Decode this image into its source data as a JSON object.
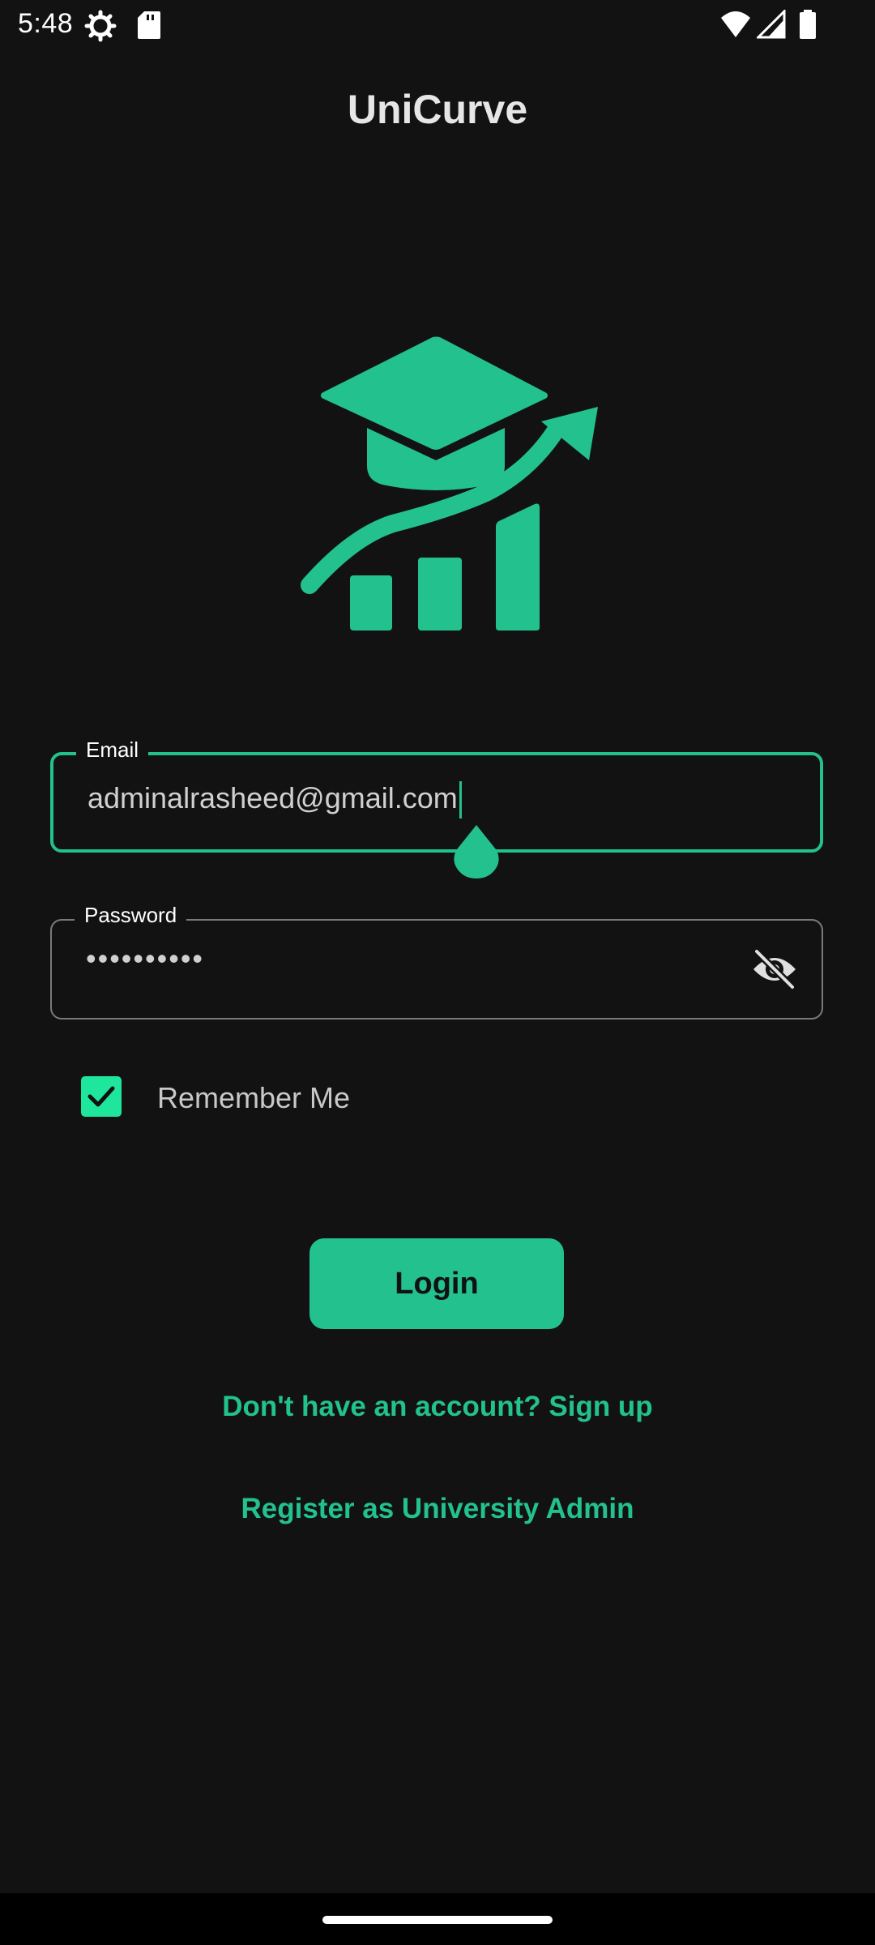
{
  "status_bar": {
    "time": "5:48",
    "icons": [
      "gear-icon",
      "sd-card-icon",
      "wifi-icon",
      "signal-icon",
      "battery-icon"
    ]
  },
  "app": {
    "title": "UniCurve",
    "logo": "graduation-cap-growth-chart-logo",
    "accent_color": "#23c18e"
  },
  "form": {
    "email": {
      "label": "Email",
      "value": "adminalrasheed@gmail.com"
    },
    "password": {
      "label": "Password",
      "value": "••••••••••",
      "toggle_icon": "eye-off-icon"
    },
    "remember_me": {
      "label": "Remember Me",
      "checked": true
    },
    "login_button": "Login",
    "signup_link": "Don't have an account? Sign up",
    "admin_link": "Register as University Admin"
  }
}
